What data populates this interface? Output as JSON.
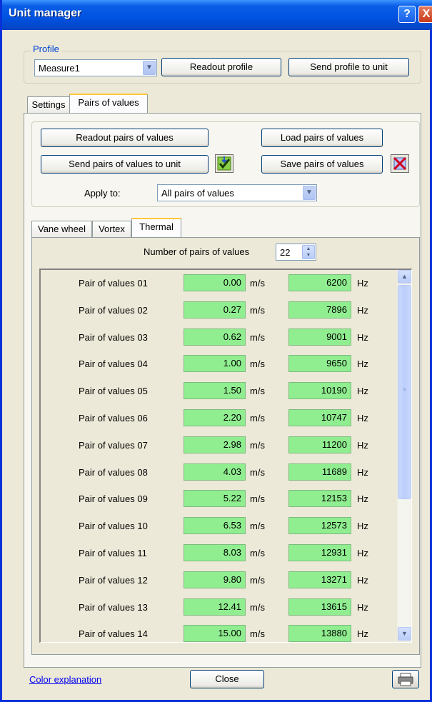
{
  "window": {
    "title": "Unit manager",
    "help_label": "?",
    "close_label": "X"
  },
  "profile": {
    "legend": "Profile",
    "selected": "Measure1",
    "readout_label": "Readout profile",
    "send_label": "Send profile to unit"
  },
  "tabs": [
    {
      "label": "Settings"
    },
    {
      "label": "Pairs of values"
    }
  ],
  "pairs": {
    "readout_label": "Readout pairs of values",
    "load_label": "Load pairs of values",
    "send_label": "Send pairs of values to unit",
    "save_label": "Save pairs of values",
    "apply_to_label": "Apply to:",
    "apply_to_value": "All pairs of values",
    "send_status_icon": "check-arrow-icon",
    "save_status_icon": "error-x-icon"
  },
  "subtabs": [
    {
      "label": "Vane wheel"
    },
    {
      "label": "Vortex"
    },
    {
      "label": "Thermal"
    }
  ],
  "thermal": {
    "count_label": "Number of pairs of values",
    "count_value": "22",
    "velocity_unit": "m/s",
    "frequency_unit": "Hz",
    "rows": [
      {
        "label": "Pair of values 01",
        "velocity": "0.00",
        "frequency": "6200"
      },
      {
        "label": "Pair of values 02",
        "velocity": "0.27",
        "frequency": "7896"
      },
      {
        "label": "Pair of values 03",
        "velocity": "0.62",
        "frequency": "9001"
      },
      {
        "label": "Pair of values 04",
        "velocity": "1.00",
        "frequency": "9650"
      },
      {
        "label": "Pair of values 05",
        "velocity": "1.50",
        "frequency": "10190"
      },
      {
        "label": "Pair of values 06",
        "velocity": "2.20",
        "frequency": "10747"
      },
      {
        "label": "Pair of values 07",
        "velocity": "2.98",
        "frequency": "11200"
      },
      {
        "label": "Pair of values 08",
        "velocity": "4.03",
        "frequency": "11689"
      },
      {
        "label": "Pair of values 09",
        "velocity": "5.22",
        "frequency": "12153"
      },
      {
        "label": "Pair of values 10",
        "velocity": "6.53",
        "frequency": "12573"
      },
      {
        "label": "Pair of values 11",
        "velocity": "8.03",
        "frequency": "12931"
      },
      {
        "label": "Pair of values 12",
        "velocity": "9.80",
        "frequency": "13271"
      },
      {
        "label": "Pair of values 13",
        "velocity": "12.41",
        "frequency": "13615"
      },
      {
        "label": "Pair of values 14",
        "velocity": "15.00",
        "frequency": "13880"
      }
    ]
  },
  "footer": {
    "color_link": "Color explanation",
    "close_label": "Close",
    "print_icon": "printer-icon"
  },
  "colors": {
    "value_cell": "#90ee90",
    "title_bar": "#0054e3",
    "dialog_bg": "#ece9d8"
  }
}
